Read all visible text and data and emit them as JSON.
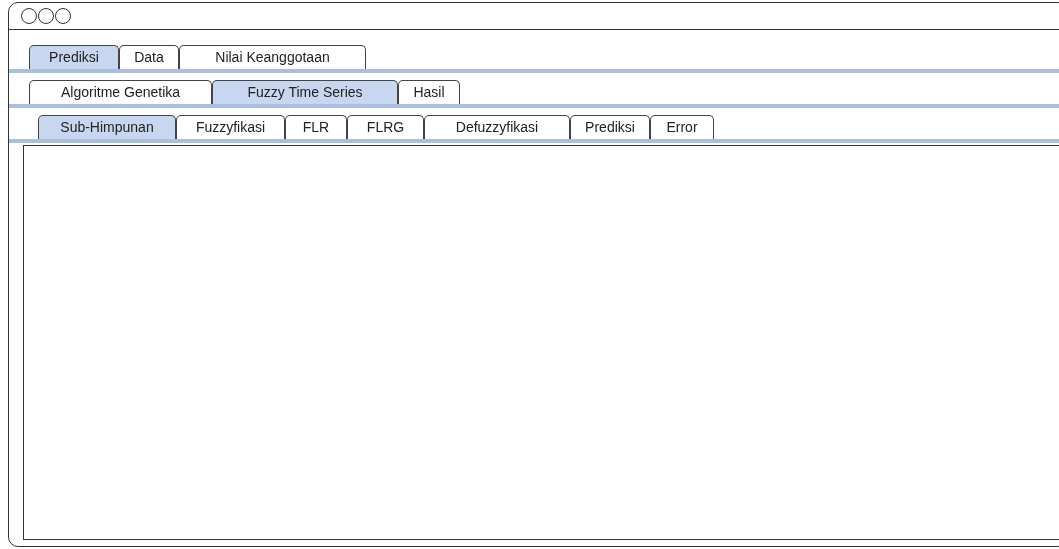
{
  "tab_rows": [
    {
      "tabs": [
        {
          "label": "Prediksi",
          "selected": true
        },
        {
          "label": "Data",
          "selected": false
        },
        {
          "label": "Nilai Keanggotaan",
          "selected": false
        }
      ]
    },
    {
      "tabs": [
        {
          "label": "Algoritme Genetika",
          "selected": false
        },
        {
          "label": "Fuzzy Time Series",
          "selected": true
        },
        {
          "label": "Hasil",
          "selected": false
        }
      ]
    },
    {
      "tabs": [
        {
          "label": "Sub-Himpunan",
          "selected": true
        },
        {
          "label": "Fuzzyfikasi",
          "selected": false
        },
        {
          "label": "FLR",
          "selected": false
        },
        {
          "label": "FLRG",
          "selected": false
        },
        {
          "label": "Defuzzyfikasi",
          "selected": false
        },
        {
          "label": "Prediksi",
          "selected": false
        },
        {
          "label": "Error",
          "selected": false
        }
      ]
    }
  ]
}
